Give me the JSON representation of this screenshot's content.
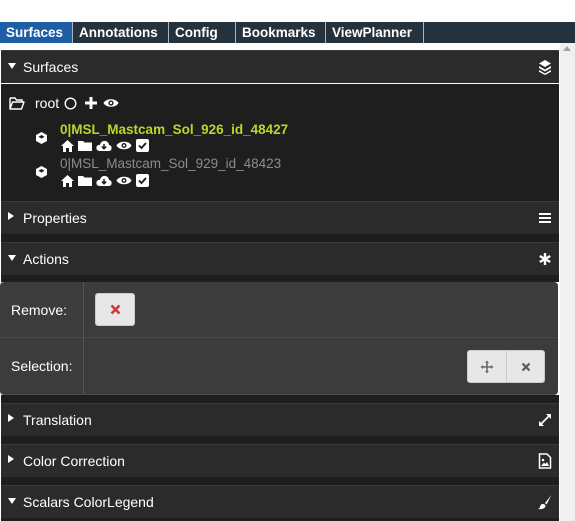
{
  "tabs": [
    {
      "label": "Surfaces",
      "active": true
    },
    {
      "label": "Annotations",
      "active": false
    },
    {
      "label": "Config",
      "active": false
    },
    {
      "label": "Bookmarks",
      "active": false
    },
    {
      "label": "ViewPlanner",
      "active": false
    }
  ],
  "sections": {
    "surfaces": {
      "title": "Surfaces",
      "icon": "layers-icon",
      "expanded": true
    },
    "properties": {
      "title": "Properties",
      "icon": "menu-icon",
      "expanded": false
    },
    "actions": {
      "title": "Actions",
      "icon": "asterisk-icon",
      "expanded": true
    },
    "translation": {
      "title": "Translation",
      "icon": "expand-icon",
      "expanded": false
    },
    "color_correction": {
      "title": "Color Correction",
      "icon": "image-file-icon",
      "expanded": false
    },
    "scalars_legend": {
      "title": "Scalars ColorLegend",
      "icon": "brush-icon",
      "expanded": true
    }
  },
  "tree": {
    "root_label": "root",
    "layers": [
      {
        "name": "0|MSL_Mastcam_Sol_926_id_48427",
        "visible": true
      },
      {
        "name": "0|MSL_Mastcam_Sol_929_id_48423",
        "visible": false
      }
    ]
  },
  "actions": {
    "remove_label": "Remove:",
    "selection_label": "Selection:"
  },
  "colors": {
    "tab_bar": "#24323e",
    "tab_active": "#1d5ea7",
    "layer_active": "#b9d72a",
    "remove_x": "#d9343b"
  }
}
